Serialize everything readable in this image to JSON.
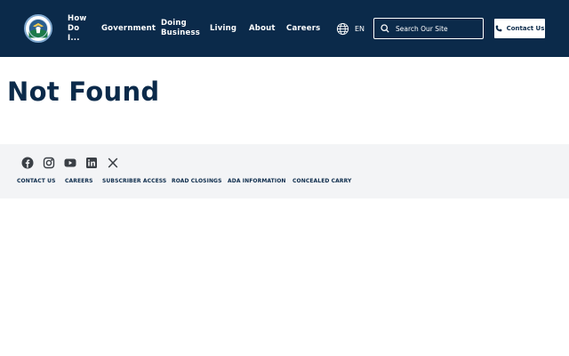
{
  "header": {
    "nav": [
      {
        "label": "How Do I..."
      },
      {
        "label": "Government"
      },
      {
        "label": "Doing Business"
      },
      {
        "label": "Living"
      },
      {
        "label": "About"
      },
      {
        "label": "Careers"
      }
    ],
    "language": "EN",
    "search_placeholder": "Search Our Site",
    "contact_label": "Contact Us",
    "bg_color": "#0b2a4a"
  },
  "main": {
    "title": "Not Found"
  },
  "footer": {
    "social_icons": [
      "facebook-icon",
      "instagram-icon",
      "youtube-icon",
      "linkedin-icon",
      "x-icon"
    ],
    "links": [
      {
        "label": "CONTACT US"
      },
      {
        "label": "CAREERS"
      },
      {
        "label": "SUBSCRIBER ACCESS"
      },
      {
        "label": "ROAD CLOSINGS"
      },
      {
        "label": "ADA INFORMATION"
      },
      {
        "label": "CONCEALED CARRY"
      }
    ],
    "bg_color": "#f3f4f6"
  }
}
